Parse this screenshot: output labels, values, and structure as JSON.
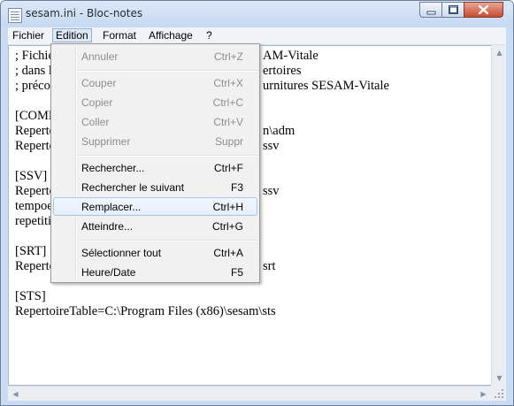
{
  "window": {
    "title": "sesam.ini - Bloc-notes"
  },
  "menubar": {
    "items": [
      "Fichier",
      "Edition",
      "Format",
      "Affichage",
      "?"
    ],
    "active": "Edition"
  },
  "editor": {
    "lines": [
      "; Fichie",
      "; dans l",
      "; précor",
      "",
      "[COMM",
      "Reperto",
      "Reperto",
      "",
      "[SSV]",
      "Reperto",
      "tempoe",
      "repetiti",
      "",
      "[SRT]",
      "Reperto",
      "",
      "[STS]",
      "RepertoireTable=C:\\Program Files (x86)\\sesam\\sts"
    ],
    "visible_fragments_right": [
      "AM-Vitale",
      "ertoires",
      "urnitures SESAM-Vitale",
      "",
      "",
      "n\\adm",
      "ssv",
      "",
      "",
      "ssv",
      "",
      "",
      "",
      "",
      "srt"
    ]
  },
  "edit_menu": {
    "items": [
      {
        "label": "Annuler",
        "shortcut": "Ctrl+Z",
        "enabled": false
      },
      {
        "label": "Couper",
        "shortcut": "Ctrl+X",
        "enabled": false
      },
      {
        "label": "Copier",
        "shortcut": "Ctrl+C",
        "enabled": false
      },
      {
        "label": "Coller",
        "shortcut": "Ctrl+V",
        "enabled": false
      },
      {
        "label": "Supprimer",
        "shortcut": "Suppr",
        "enabled": false
      },
      {
        "label": "Rechercher...",
        "shortcut": "Ctrl+F",
        "enabled": true
      },
      {
        "label": "Rechercher le suivant",
        "shortcut": "F3",
        "enabled": true
      },
      {
        "label": "Remplacer...",
        "shortcut": "Ctrl+H",
        "enabled": true,
        "highlighted": true
      },
      {
        "label": "Atteindre...",
        "shortcut": "Ctrl+G",
        "enabled": true
      },
      {
        "label": "Sélectionner tout",
        "shortcut": "Ctrl+A",
        "enabled": true
      },
      {
        "label": "Heure/Date",
        "shortcut": "F5",
        "enabled": true
      }
    ]
  },
  "colors": {
    "frame": "#c9dcf3",
    "close_button": "#c84b30",
    "highlight_border": "#a8c6ec",
    "disabled_text": "#8d8d8d"
  }
}
